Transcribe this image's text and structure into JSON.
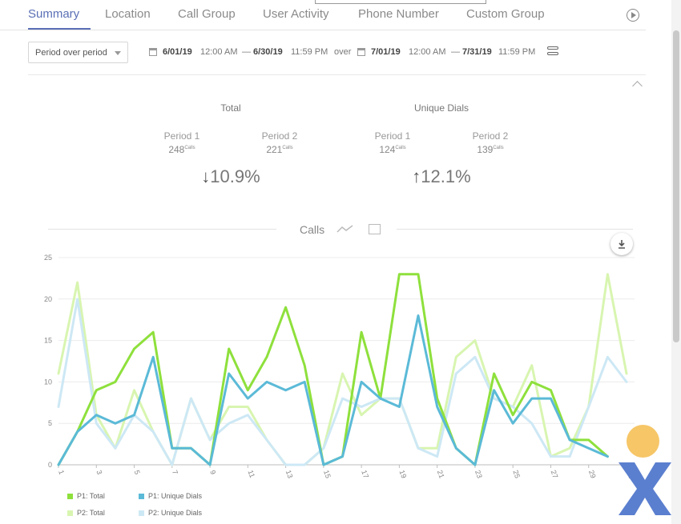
{
  "tabs": [
    {
      "label": "Summary",
      "active": true
    },
    {
      "label": "Location"
    },
    {
      "label": "Call Group"
    },
    {
      "label": "User Activity"
    },
    {
      "label": "Phone Number"
    },
    {
      "label": "Custom Group"
    }
  ],
  "controls": {
    "period_select": "Period over period",
    "range1_start_date": "6/01/19",
    "range1_start_time": "12:00 AM",
    "range1_end_date": "6/30/19",
    "range1_end_time": "11:59 PM",
    "over_label": "over",
    "range2_start_date": "7/01/19",
    "range2_start_time": "12:00 AM",
    "range2_end_date": "7/31/19",
    "range2_end_time": "11:59 PM",
    "dash": "—"
  },
  "stats": {
    "total": {
      "title": "Total",
      "p1_label": "Period 1",
      "p1_value": "248",
      "p1_unit": "Calls",
      "p2_label": "Period 2",
      "p2_value": "221",
      "p2_unit": "Calls",
      "change_arrow": "↓",
      "change": "10.9%"
    },
    "unique": {
      "title": "Unique Dials",
      "p1_label": "Period 1",
      "p1_value": "124",
      "p1_unit": "Calls",
      "p2_label": "Period 2",
      "p2_value": "139",
      "p2_unit": "Calls",
      "change_arrow": "↑",
      "change": "12.1%"
    }
  },
  "chart_section": {
    "title": "Calls"
  },
  "chart_data": {
    "type": "line",
    "x": [
      1,
      2,
      3,
      4,
      5,
      6,
      7,
      8,
      9,
      10,
      11,
      12,
      13,
      14,
      15,
      16,
      17,
      18,
      19,
      20,
      21,
      22,
      23,
      24,
      25,
      26,
      27,
      28,
      29,
      30,
      31
    ],
    "x_tick_labels": [
      "1",
      "3",
      "5",
      "7",
      "9",
      "11",
      "13",
      "15",
      "17",
      "19",
      "21",
      "23",
      "25",
      "27",
      "29",
      "31"
    ],
    "y_tick_labels": [
      "0",
      "5",
      "10",
      "15",
      "20",
      "25"
    ],
    "ylim": [
      0,
      25
    ],
    "grid": true,
    "legend_position": "bottom-left",
    "series": [
      {
        "name": "P1: Total",
        "color": "#8ee03c",
        "values": [
          0,
          4,
          9,
          10,
          14,
          16,
          2,
          2,
          0,
          14,
          9,
          13,
          19,
          12,
          0,
          1,
          16,
          8,
          23,
          23,
          8,
          2,
          0,
          11,
          6,
          10,
          9,
          3,
          3,
          1,
          null
        ]
      },
      {
        "name": "P1: Unique Dials",
        "color": "#5bbad7",
        "values": [
          0,
          4,
          6,
          5,
          6,
          13,
          2,
          2,
          0,
          11,
          8,
          10,
          9,
          10,
          0,
          1,
          10,
          8,
          7,
          18,
          7,
          2,
          0,
          9,
          5,
          8,
          8,
          3,
          2,
          1,
          null
        ]
      },
      {
        "name": "P2: Total",
        "color": "#d8f5b0",
        "values": [
          11,
          22,
          6,
          2,
          9,
          4,
          0,
          8,
          3,
          7,
          7,
          3,
          0,
          0,
          2,
          11,
          6,
          8,
          8,
          2,
          2,
          13,
          15,
          8,
          7,
          12,
          1,
          2,
          7,
          23,
          11
        ]
      },
      {
        "name": "P2: Unique Dials",
        "color": "#cde8f5",
        "values": [
          7,
          20,
          5,
          2,
          6,
          4,
          0,
          8,
          3,
          5,
          6,
          3,
          0,
          0,
          2,
          8,
          7,
          8,
          8,
          2,
          1,
          11,
          13,
          8,
          7,
          5,
          1,
          1,
          7,
          13,
          10
        ]
      }
    ]
  }
}
